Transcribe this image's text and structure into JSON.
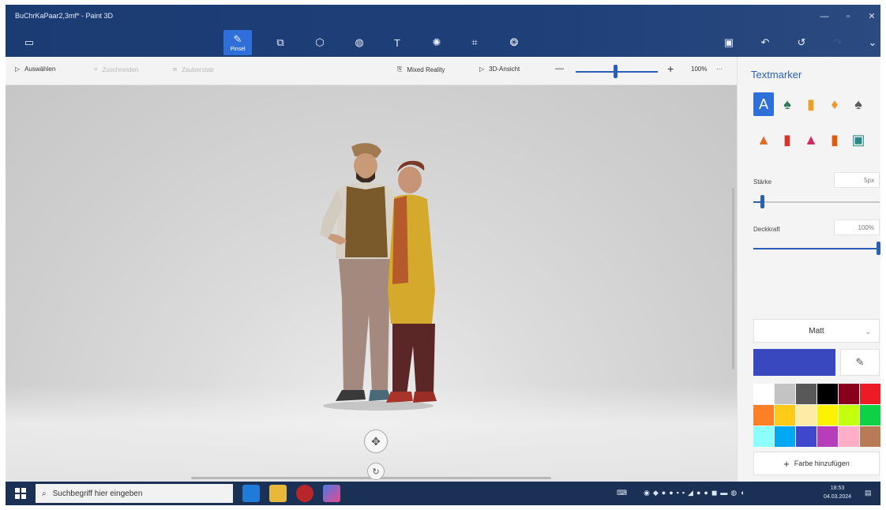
{
  "window": {
    "title": "BuChrKaPaar2,3mf* - Paint 3D"
  },
  "toolbar": {
    "active_tool_label": "Pinsel",
    "text_tool_glyph": "T"
  },
  "subbar": {
    "select_label": "Auswählen",
    "crop_label": "Zuschneiden",
    "magic_label": "Zauberstab",
    "mixed_reality_label": "Mixed Reality",
    "view3d_label": "3D-Ansicht",
    "zoom_minus": "—",
    "zoom_plus": "+",
    "zoom_value": "100%",
    "more": "···"
  },
  "panel": {
    "title": "Textmarker",
    "thickness_label": "Stärke",
    "thickness_value": "5px",
    "opacity_label": "Deckkraft",
    "opacity_value": "100%",
    "finish_select": "Matt",
    "add_color_label": "Farbe hinzufügen",
    "current_color": "#3a48c0",
    "swatches": [
      "#ffffff",
      "#c3c3c3",
      "#585858",
      "#000000",
      "#88001b",
      "#ec1c24",
      "#ff7f27",
      "#ffca18",
      "#fdeca6",
      "#fff200",
      "#c4ff0e",
      "#0ed145",
      "#8cfffb",
      "#00a8f3",
      "#3f48cc",
      "#b83dba",
      "#ffaec8",
      "#b97a56"
    ]
  },
  "taskbar": {
    "search_placeholder": "Suchbegriff hier eingeben",
    "time": "18:53",
    "date": "04.03.2024"
  }
}
